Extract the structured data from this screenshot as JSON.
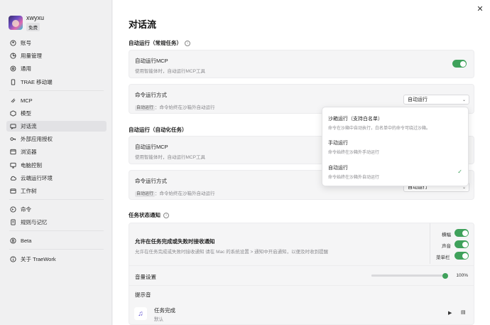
{
  "profile": {
    "username": "xwyxu",
    "plan": "免费"
  },
  "sidebar": {
    "groups": [
      [
        {
          "label": "账号",
          "icon": "user-icon"
        },
        {
          "label": "用量管理",
          "icon": "chart-icon"
        },
        {
          "label": "通用",
          "icon": "gear-icon"
        },
        {
          "label": "TRAE 移动端",
          "icon": "phone-icon"
        }
      ],
      [
        {
          "label": "MCP",
          "icon": "mcp-icon"
        },
        {
          "label": "模型",
          "icon": "cube-icon"
        },
        {
          "label": "对话流",
          "icon": "chat-flow-icon",
          "active": true
        },
        {
          "label": "外部应用授权",
          "icon": "key-icon"
        },
        {
          "label": "浏览器",
          "icon": "browser-icon"
        },
        {
          "label": "电脑控制",
          "icon": "monitor-icon"
        },
        {
          "label": "云端运行环境",
          "icon": "cloud-icon"
        },
        {
          "label": "工作树",
          "icon": "tree-icon"
        }
      ],
      [
        {
          "label": "命令",
          "icon": "terminal-icon"
        },
        {
          "label": "规则与记忆",
          "icon": "book-icon"
        }
      ],
      [
        {
          "label": "Beta",
          "icon": "beta-icon"
        }
      ],
      [
        {
          "label": "关于 TraeWork",
          "icon": "info-icon"
        }
      ]
    ]
  },
  "main": {
    "title": "对话流",
    "close_icon": "close-icon",
    "auto_run_normal": {
      "section_title": "自动运行（常规任务）",
      "mcp_title": "自动运行MCP",
      "mcp_desc": "使用智能体时，自动运行MCP工具",
      "cmd_title": "命令运行方式",
      "cmd_tag": "自动运行",
      "cmd_desc": "：命令始终在沙箱外自动运行",
      "select_value": "自动运行"
    },
    "auto_run_auto": {
      "section_title": "自动运行（自动化任务）",
      "mcp_title": "自动运行MCP",
      "mcp_desc": "使用智能体时，自动运行MCP工具",
      "cmd_title": "命令运行方式",
      "cmd_tag": "自动运行",
      "cmd_desc": "：命令始终在沙箱外自动运行",
      "select_value": "自动运行"
    },
    "dropdown": {
      "options": [
        {
          "title": "沙箱运行（支持白名单）",
          "desc": "命令在沙箱中自动执行，白名单中的命令可绕过沙箱。"
        },
        {
          "title": "手动运行",
          "desc": "命令始终在沙箱外手动运行"
        },
        {
          "title": "自动运行",
          "desc": "命令始终在沙箱外自动运行",
          "selected": true
        }
      ],
      "check": "✓"
    },
    "notify": {
      "section_title": "任务状态通知",
      "title": "允许在任务完成或失败时接收通知",
      "desc": "允许在任务完成或失败时接收通知 请在 Mac 的系统设置 > 通知中开启通知，以便及时收到提醒",
      "toggles": [
        {
          "label": "横幅",
          "on": true
        },
        {
          "label": "声音",
          "on": true
        },
        {
          "label": "菜单栏",
          "on": true
        }
      ],
      "volume_label": "音量设置",
      "volume_value": "100%",
      "volume_level": 1.0,
      "tone_label": "提示音",
      "tone_item_title": "任务完成",
      "tone_item_sub": "默认"
    }
  },
  "colors": {
    "accent": "#3fa15b",
    "sidebar_bg": "#f0f0f1",
    "card_bg": "#f5f5f6"
  }
}
